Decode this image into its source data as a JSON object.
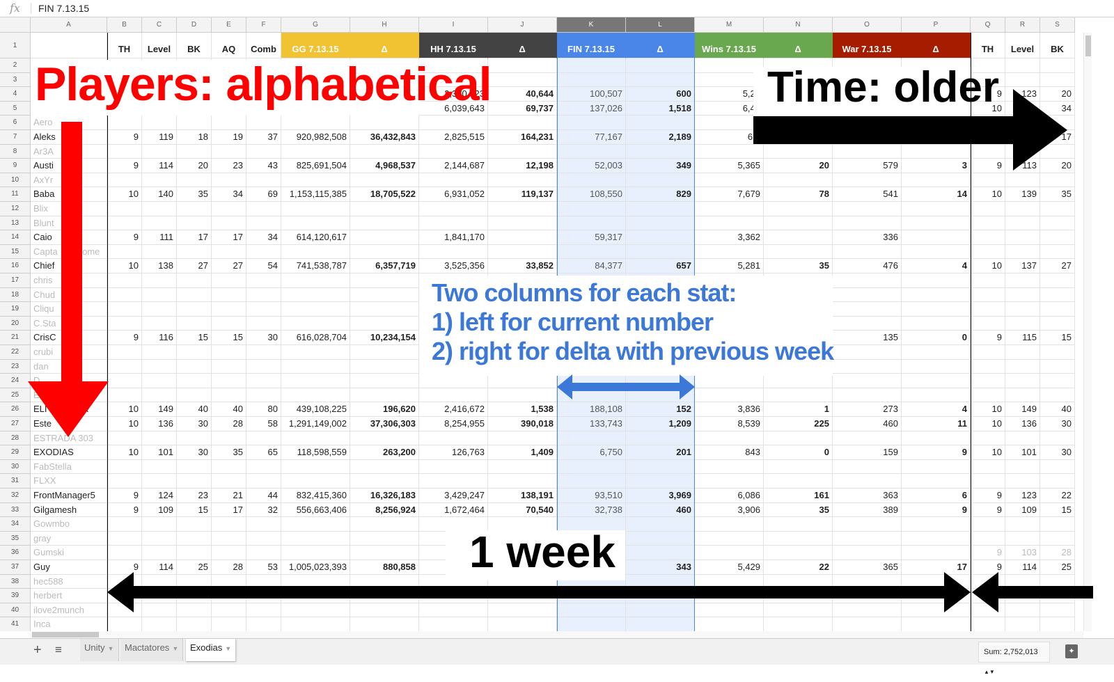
{
  "formula_bar": {
    "icon": "fx-icon",
    "value": "FIN 7.13.15"
  },
  "columns": [
    "A",
    "B",
    "C",
    "D",
    "E",
    "F",
    "G",
    "H",
    "I",
    "J",
    "K",
    "L",
    "M",
    "N",
    "O",
    "P",
    "Q",
    "R",
    "S"
  ],
  "header_row": [
    "",
    "TH",
    "Level",
    "BK",
    "AQ",
    "Comb",
    "GG 7.13.15",
    "Δ",
    "HH 7.13.15",
    "Δ",
    "FIN 7.13.15",
    "Δ",
    "Wins 7.13.15",
    "Δ",
    "War 7.13.15",
    "Δ",
    "TH",
    "Level",
    "BK"
  ],
  "header_colors": {
    "G": "#f1c232",
    "H": "#f1c232",
    "I": "#434343",
    "J": "#434343",
    "K": "#4a86e8",
    "L": "#4a86e8",
    "M": "#6aa84f",
    "N": "#6aa84f",
    "O": "#a61c00",
    "P": "#a61c00"
  },
  "selected_columns": [
    "K",
    "L"
  ],
  "rows": [
    {
      "n": 2,
      "name": "",
      "dim": false,
      "v": []
    },
    {
      "n": 3,
      "name": "",
      "dim": false,
      "v": []
    },
    {
      "n": 4,
      "name": "",
      "dim": false,
      "v": [
        "",
        "",
        "",
        "",
        "",
        "",
        "",
        "2,340,923",
        "40,644",
        "100,507",
        "600",
        "5,24",
        "",
        "",
        "",
        "9",
        "123",
        "20"
      ]
    },
    {
      "n": 5,
      "name": "",
      "dim": false,
      "v": [
        "",
        "",
        "",
        "",
        "",
        "",
        "",
        "6,039,643",
        "69,737",
        "137,026",
        "1,518",
        "6,44",
        "",
        "",
        "",
        "10",
        "",
        "34"
      ]
    },
    {
      "n": 6,
      "name": "Aero",
      "dim": true,
      "v": []
    },
    {
      "n": 7,
      "name": "Aleks",
      "dim": false,
      "v": [
        "9",
        "119",
        "18",
        "19",
        "37",
        "920,982,508",
        "36,432,843",
        "2,825,515",
        "164,231",
        "77,167",
        "2,189",
        "6,8",
        "",
        "",
        "",
        "",
        "",
        "17"
      ]
    },
    {
      "n": 8,
      "name": "Ar3A",
      "dim": true,
      "v": []
    },
    {
      "n": 9,
      "name": "Austi",
      "dim": false,
      "v": [
        "9",
        "114",
        "20",
        "23",
        "43",
        "825,691,504",
        "4,968,537",
        "2,144,687",
        "12,198",
        "52,003",
        "349",
        "5,365",
        "20",
        "579",
        "3",
        "9",
        "113",
        "20"
      ]
    },
    {
      "n": 10,
      "name": "AxYr",
      "dim": true,
      "v": []
    },
    {
      "n": 11,
      "name": "Baba",
      "dim": false,
      "v": [
        "10",
        "140",
        "35",
        "34",
        "69",
        "1,153,115,385",
        "18,705,522",
        "6,931,052",
        "119,137",
        "108,550",
        "829",
        "7,679",
        "78",
        "541",
        "14",
        "10",
        "139",
        "35"
      ]
    },
    {
      "n": 12,
      "name": "Blix",
      "dim": true,
      "v": []
    },
    {
      "n": 13,
      "name": "Blunt",
      "dim": true,
      "v": []
    },
    {
      "n": 14,
      "name": "Caio",
      "dim": false,
      "v": [
        "9",
        "111",
        "17",
        "17",
        "34",
        "614,120,617",
        "",
        "1,841,170",
        "",
        "59,317",
        "",
        "3,362",
        "",
        "336",
        "",
        "",
        "",
        ""
      ]
    },
    {
      "n": 15,
      "name": "Capta      esome",
      "dim": true,
      "v": []
    },
    {
      "n": 16,
      "name": "Chief",
      "dim": false,
      "v": [
        "10",
        "138",
        "27",
        "27",
        "54",
        "741,538,787",
        "6,357,719",
        "3,525,356",
        "33,852",
        "84,377",
        "657",
        "5,281",
        "35",
        "476",
        "4",
        "10",
        "137",
        "27"
      ]
    },
    {
      "n": 17,
      "name": "chris",
      "dim": true,
      "v": []
    },
    {
      "n": 18,
      "name": "Chud",
      "dim": true,
      "v": []
    },
    {
      "n": 19,
      "name": "Cliqu",
      "dim": true,
      "v": []
    },
    {
      "n": 20,
      "name": "C.Sta      le",
      "dim": true,
      "v": []
    },
    {
      "n": 21,
      "name": "CrisC",
      "dim": false,
      "v": [
        "9",
        "116",
        "15",
        "15",
        "30",
        "616,028,704",
        "10,234,154",
        "",
        "",
        "",
        "",
        "",
        "",
        "135",
        "0",
        "9",
        "115",
        "15"
      ]
    },
    {
      "n": 22,
      "name": "crubi",
      "dim": true,
      "v": []
    },
    {
      "n": 23,
      "name": "dan",
      "dim": true,
      "v": []
    },
    {
      "n": 24,
      "name": "D",
      "dim": true,
      "v": []
    },
    {
      "n": 25,
      "name": "E",
      "dim": true,
      "v": []
    },
    {
      "n": 26,
      "name": "ELI         HER",
      "dim": false,
      "v": [
        "10",
        "149",
        "40",
        "40",
        "80",
        "439,108,225",
        "196,620",
        "2,416,672",
        "1,538",
        "188,108",
        "152",
        "3,836",
        "1",
        "273",
        "4",
        "10",
        "149",
        "40"
      ]
    },
    {
      "n": 27,
      "name": "Este",
      "dim": false,
      "v": [
        "10",
        "136",
        "30",
        "28",
        "58",
        "1,291,149,002",
        "37,306,303",
        "8,254,955",
        "390,018",
        "133,743",
        "1,209",
        "8,539",
        "225",
        "460",
        "11",
        "10",
        "136",
        "30"
      ]
    },
    {
      "n": 28,
      "name": "ESTRADA 303",
      "dim": true,
      "v": []
    },
    {
      "n": 29,
      "name": "EXODIAS",
      "dim": false,
      "v": [
        "10",
        "101",
        "30",
        "35",
        "65",
        "118,598,559",
        "263,200",
        "126,763",
        "1,409",
        "6,750",
        "201",
        "843",
        "0",
        "159",
        "9",
        "10",
        "101",
        "30"
      ]
    },
    {
      "n": 30,
      "name": "FabStella",
      "dim": true,
      "v": []
    },
    {
      "n": 31,
      "name": "FLXX",
      "dim": true,
      "v": []
    },
    {
      "n": 32,
      "name": "FrontManager5",
      "dim": false,
      "v": [
        "9",
        "124",
        "23",
        "21",
        "44",
        "832,415,360",
        "16,326,183",
        "3,429,247",
        "138,191",
        "93,510",
        "3,969",
        "6,086",
        "161",
        "363",
        "6",
        "9",
        "123",
        "22"
      ]
    },
    {
      "n": 33,
      "name": "Gilgamesh",
      "dim": false,
      "v": [
        "9",
        "109",
        "15",
        "17",
        "32",
        "556,663,406",
        "8,256,924",
        "1,672,464",
        "70,540",
        "32,738",
        "460",
        "3,906",
        "35",
        "389",
        "9",
        "9",
        "109",
        "15"
      ]
    },
    {
      "n": 34,
      "name": "Gowmbo",
      "dim": true,
      "v": []
    },
    {
      "n": 35,
      "name": "gray",
      "dim": true,
      "v": []
    },
    {
      "n": 36,
      "name": "Gumski",
      "dim": true,
      "v": [
        "",
        "",
        "",
        "",
        "",
        "",
        "",
        "",
        "",
        "",
        "",
        "",
        "",
        "",
        "",
        "9",
        "103",
        "28"
      ]
    },
    {
      "n": 37,
      "name": "Guy",
      "dim": false,
      "v": [
        "9",
        "114",
        "25",
        "28",
        "53",
        "1,005,023,393",
        "880,858",
        "",
        "",
        "",
        "343",
        "5,429",
        "22",
        "365",
        "17",
        "9",
        "114",
        "25"
      ]
    },
    {
      "n": 38,
      "name": "hec588",
      "dim": true,
      "v": []
    },
    {
      "n": 39,
      "name": "herbert",
      "dim": true,
      "v": []
    },
    {
      "n": 40,
      "name": "ilove2munch",
      "dim": true,
      "v": []
    },
    {
      "n": 41,
      "name": "Inca",
      "dim": true,
      "v": []
    }
  ],
  "annotations": {
    "players": "Players: alphabetical",
    "time": "Time: older",
    "two_columns": [
      "Two columns for each stat:",
      "1) left for current number",
      "2) right for delta with previous week"
    ],
    "week": "1 week",
    "colors": {
      "red": "#ff0000",
      "blue": "#3c78d8",
      "black": "#000000"
    }
  },
  "sheet_tabs": [
    {
      "label": "Unity",
      "active": false
    },
    {
      "label": "Mactatores",
      "active": false
    },
    {
      "label": "Exodias",
      "active": true
    }
  ],
  "bottom_bar": {
    "add_icon": "plus-icon",
    "list_icon": "menu-icon",
    "sum": "Sum: 2,752,013",
    "explore_icon": "explore-icon"
  }
}
